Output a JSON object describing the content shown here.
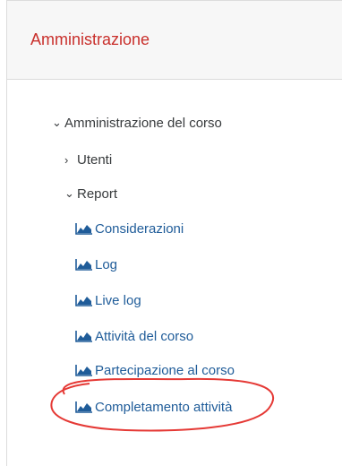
{
  "panel": {
    "title": "Amministrazione"
  },
  "tree": {
    "course_admin": {
      "label": "Amministrazione del corso",
      "chevron": "chevron-down"
    },
    "users": {
      "label": "Utenti",
      "chevron": "chevron-right"
    },
    "reports": {
      "label": "Report",
      "chevron": "chevron-down",
      "items": [
        {
          "label": "Considerazioni",
          "icon": "report-chart-icon"
        },
        {
          "label": "Log",
          "icon": "report-chart-icon"
        },
        {
          "label": "Live log",
          "icon": "report-chart-icon"
        },
        {
          "label": "Attività del corso",
          "icon": "report-chart-icon"
        },
        {
          "label": "Partecipazione al corso",
          "icon": "report-chart-icon"
        },
        {
          "label": "Completamento attività",
          "icon": "report-chart-icon"
        }
      ]
    }
  },
  "colors": {
    "title": "#c9302c",
    "link": "#1f5c99",
    "icon": "#1f5c99",
    "highlight": "#e53935"
  }
}
